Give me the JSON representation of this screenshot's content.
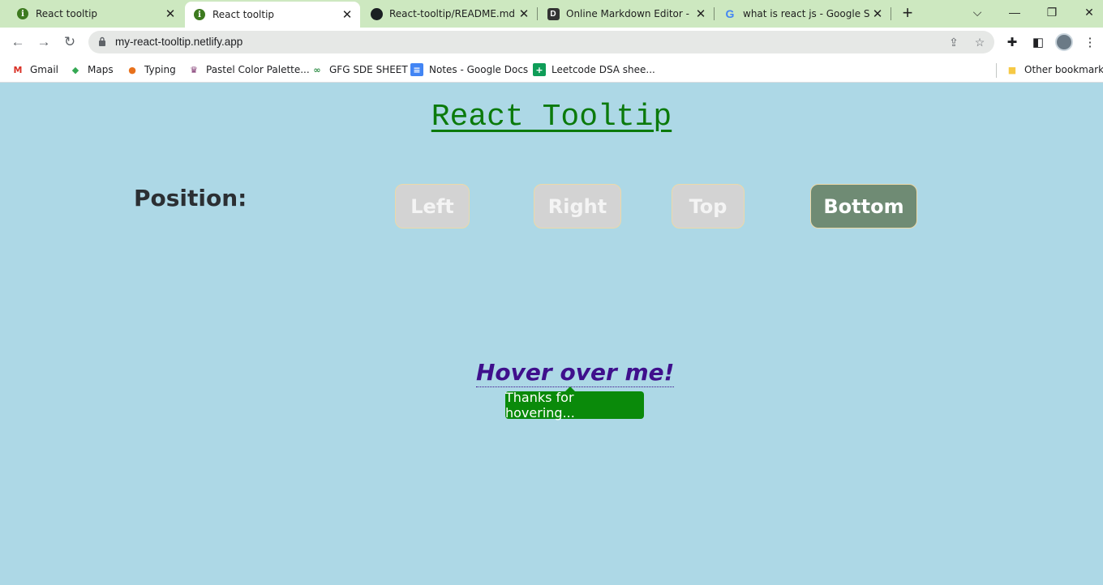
{
  "browser": {
    "tabs": [
      {
        "title": "React tooltip",
        "favicon": "green-info-icon",
        "active": false
      },
      {
        "title": "React tooltip",
        "favicon": "green-info-icon",
        "active": true
      },
      {
        "title": "React-tooltip/README.md at",
        "favicon": "github-icon",
        "active": false
      },
      {
        "title": "Online Markdown Editor - Di",
        "favicon": "dillinger-icon",
        "active": false
      },
      {
        "title": "what is react js - Google Sear",
        "favicon": "google-icon",
        "active": false
      }
    ],
    "url": "my-react-tooltip.netlify.app",
    "bookmarks": [
      {
        "label": "Gmail",
        "icon": "gmail-icon"
      },
      {
        "label": "Maps",
        "icon": "maps-icon"
      },
      {
        "label": "Typing",
        "icon": "typing-icon"
      },
      {
        "label": "Pastel Color Palette...",
        "icon": "palette-icon"
      },
      {
        "label": "GFG SDE SHEET",
        "icon": "gfg-icon"
      },
      {
        "label": "Notes - Google Docs",
        "icon": "docs-icon"
      },
      {
        "label": "Leetcode DSA shee...",
        "icon": "sheets-icon"
      }
    ],
    "other_bookmarks": "Other bookmarks"
  },
  "page": {
    "heading": "React Tooltip",
    "position_label": "Position:",
    "buttons": [
      {
        "label": "Left",
        "selected": false
      },
      {
        "label": "Right",
        "selected": false
      },
      {
        "label": "Top",
        "selected": false
      },
      {
        "label": "Bottom",
        "selected": true
      }
    ],
    "hover_text": "Hover over me!",
    "tooltip_text": "Thanks for hovering..."
  },
  "colors": {
    "page_bg": "#add8e6",
    "heading": "#0b7a0b",
    "selected_button": "#6f8b74",
    "tooltip_bg": "#0a8a0a",
    "hover_text": "#3f0f8c"
  }
}
